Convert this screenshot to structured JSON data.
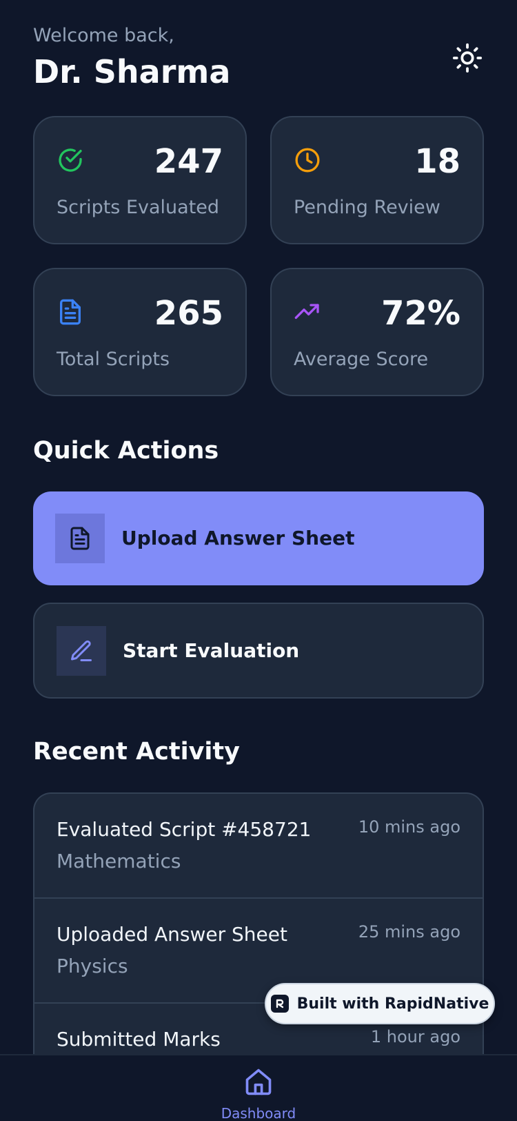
{
  "header": {
    "greeting": "Welcome back,",
    "user_name": "Dr. Sharma",
    "theme_icon": "sun-icon"
  },
  "stats": [
    {
      "value": "247",
      "label": "Scripts Evaluated",
      "icon": "check-circle-icon",
      "color": "#22c55e"
    },
    {
      "value": "18",
      "label": "Pending Review",
      "icon": "clock-icon",
      "color": "#f59e0b"
    },
    {
      "value": "265",
      "label": "Total Scripts",
      "icon": "document-icon",
      "color": "#3b82f6"
    },
    {
      "value": "72%",
      "label": "Average Score",
      "icon": "trending-up-icon",
      "color": "#a855f7"
    }
  ],
  "quick_actions": {
    "title": "Quick Actions",
    "items": [
      {
        "label": "Upload Answer Sheet",
        "icon": "document-icon"
      },
      {
        "label": "Start Evaluation",
        "icon": "pen-icon"
      }
    ]
  },
  "recent_activity": {
    "title": "Recent Activity",
    "items": [
      {
        "title": "Evaluated Script #458721",
        "subject": "Mathematics",
        "time": "10 mins ago"
      },
      {
        "title": "Uploaded Answer Sheet",
        "subject": "Physics",
        "time": "25 mins ago"
      },
      {
        "title": "Submitted Marks",
        "subject": "",
        "time": "1 hour ago"
      }
    ]
  },
  "badge": {
    "text": "Built with RapidNative"
  },
  "bottom_nav": {
    "items": [
      {
        "label": "Dashboard",
        "icon": "home-icon",
        "active": true
      }
    ]
  },
  "colors": {
    "background": "#0f172a",
    "card": "#1e293b",
    "border": "#334155",
    "accent": "#818cf8",
    "muted_text": "#94a3b8"
  }
}
